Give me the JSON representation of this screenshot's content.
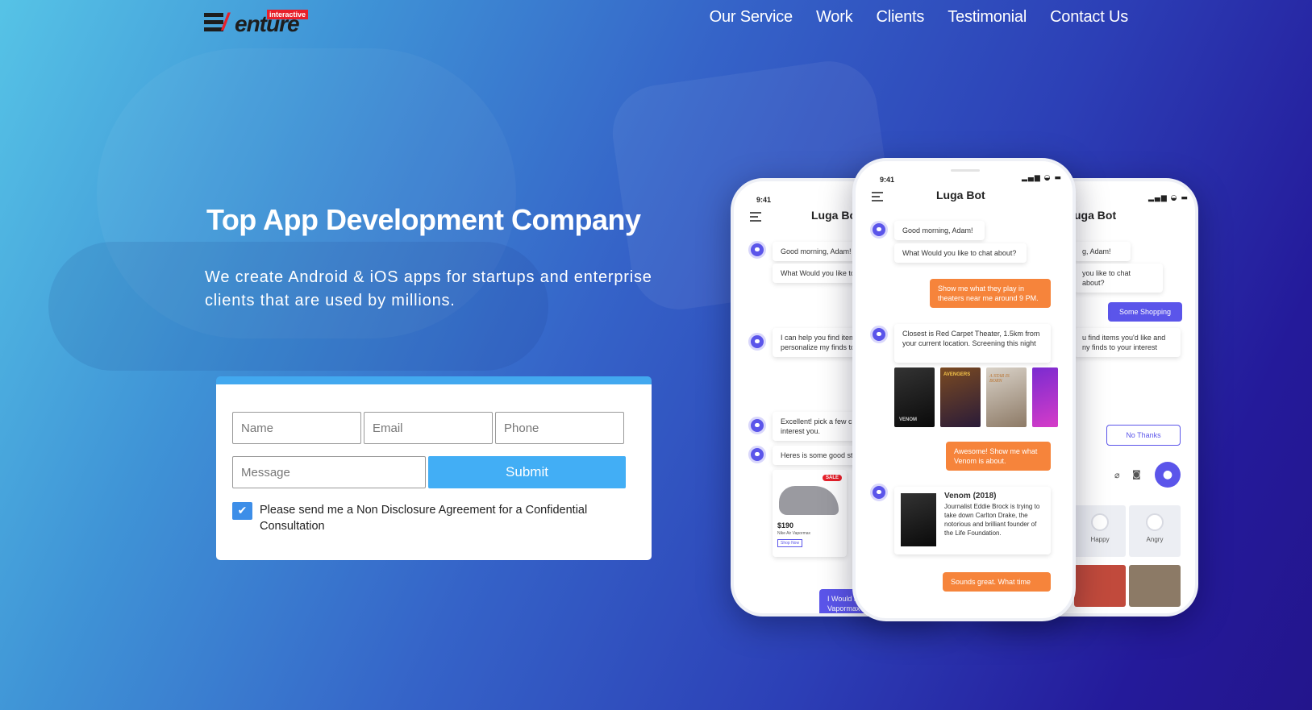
{
  "header": {
    "logo": {
      "word": "enture",
      "slash": "/",
      "tag": "interactive"
    },
    "nav": [
      "Our Service",
      "Work",
      "Clients",
      "Testimonial",
      "Contact Us"
    ]
  },
  "hero": {
    "title": "Top App Development Company",
    "subtitle": "We create Android & iOS apps for startups and enterprise clients that are used by millions."
  },
  "form": {
    "name_placeholder": "Name",
    "email_placeholder": "Email",
    "phone_placeholder": "Phone",
    "message_placeholder": "Message",
    "submit_label": "Submit",
    "nda_checked": true,
    "nda_label": "Please send me a Non Disclosure Agreement for a Confidential Consultation"
  },
  "phones": {
    "time": "9:41",
    "bot_name": "Luga Bot",
    "left": {
      "title": "Luga Bo",
      "msgs": [
        "Good morning, Adam!",
        "What Would you like to",
        "I can help you find item personalize my finds to",
        "Excellent! pick a few c interest you.",
        "Heres is some good st",
        "I Would li Vapormax"
      ],
      "shoe_price": "$190",
      "shoe_name": "Nike Air Vapormax",
      "shoe_button": "Shop Now",
      "sale_badge": "SALE"
    },
    "center": {
      "msgs": {
        "greet": "Good morning, Adam!",
        "ask": "What Would you like to chat about?",
        "user1": "Show me what they play in theaters near me around 9 PM.",
        "bot2": "Closest is Red Carpet Theater, 1.5km from your current location. Screening this night",
        "user2": "Awesome! Show me what Venom is about.",
        "movie_title": "Venom (2018)",
        "movie_desc": "Journalist Eddie Brock is trying to take down Carlton Drake, the notorious and brilliant founder of the Life Foundation.",
        "user3": "Sounds great. What time"
      },
      "posters": [
        "VENOM",
        "AVENGERS",
        "A STAR IS BORN",
        ""
      ]
    },
    "right": {
      "title": "uga Bot",
      "msgs": [
        "g, Adam!",
        "you like to chat about?",
        "Some Shopping",
        "u find items you'd like and ny finds to your interest",
        "No Thanks"
      ],
      "emotions": [
        "Happy",
        "Angry"
      ]
    }
  },
  "colors": {
    "accent": "#42aef5",
    "bot_purple": "#5b55ea",
    "user_orange": "#f6843b",
    "logo_red": "#e8202a"
  }
}
